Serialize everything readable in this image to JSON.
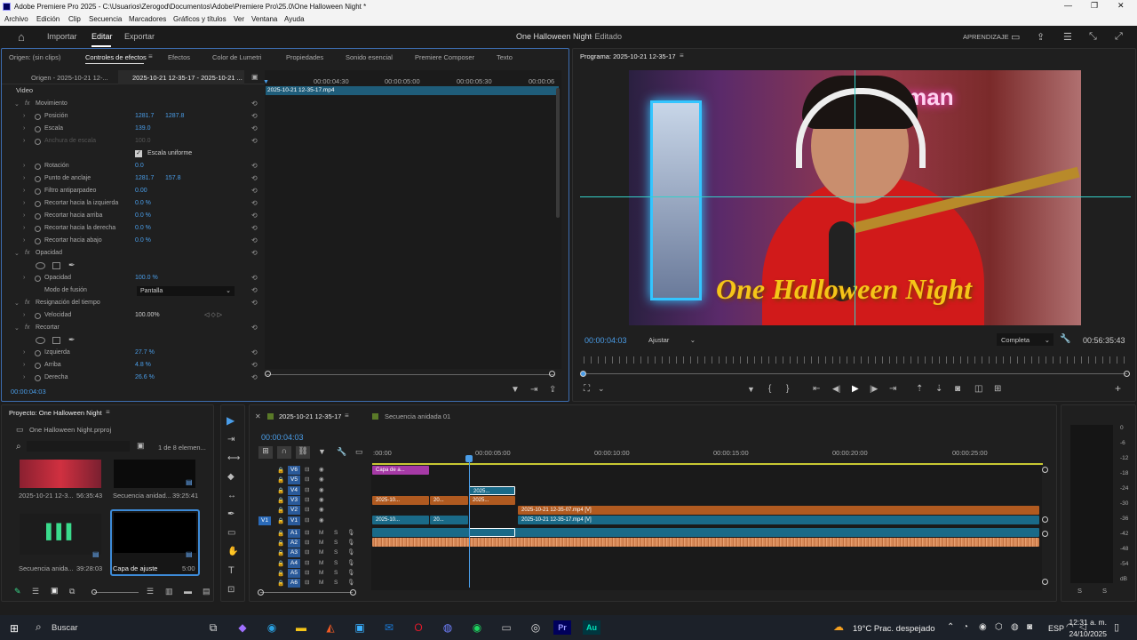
{
  "titlebar": {
    "title": "Adobe Premiere Pro 2025 - C:\\Usuarios\\Zerogod\\Documentos\\Adobe\\Premiere Pro\\25.0\\One Halloween Night *"
  },
  "menu": [
    "Archivo",
    "Edición",
    "Clip",
    "Secuencia",
    "Marcadores",
    "Gráficos y títulos",
    "Ver",
    "Ventana",
    "Ayuda"
  ],
  "appbar": {
    "import": "Importar",
    "edit": "Editar",
    "export": "Exportar",
    "project_title": "One Halloween Night",
    "project_state": "- Editado",
    "learn": "APRENDIZAJE"
  },
  "effects_panel": {
    "tabs": [
      "Origen: (sin clips)",
      "Controles de efectos",
      "Efectos",
      "Color de Lumetri",
      "Propiedades",
      "Sonido esencial",
      "Premiere Composer",
      "Texto"
    ],
    "subtabs": [
      "Origen - 2025-10-21 12-...",
      "2025-10-21 12-35-17 - 2025-10-21 ..."
    ],
    "ruler": [
      "00:00:04:30",
      "00:00:05:00",
      "00:00:05:30",
      "00:00:06"
    ],
    "clip_name": "2025-10-21 12-35-17.mp4",
    "section": "Video",
    "rows": [
      {
        "label": "Movimiento",
        "fx": true,
        "open": true
      },
      {
        "label": "Posición",
        "v1": "1281.7",
        "v2": "1287.8"
      },
      {
        "label": "Escala",
        "v1": "139.0"
      },
      {
        "label": "Anchura de escala",
        "v1": "100.0",
        "dim": true
      },
      {
        "label": "Escala uniforme",
        "check": true
      },
      {
        "label": "Rotación",
        "v1": "0.0"
      },
      {
        "label": "Punto de anclaje",
        "v1": "1281.7",
        "v2": "157.8"
      },
      {
        "label": "Filtro antiparpadeo",
        "v1": "0.00"
      },
      {
        "label": "Recortar hacia la izquierda",
        "v1": "0.0 %"
      },
      {
        "label": "Recortar hacia arriba",
        "v1": "0.0 %"
      },
      {
        "label": "Recortar hacia la derecha",
        "v1": "0.0 %"
      },
      {
        "label": "Recortar hacia abajo",
        "v1": "0.0 %"
      },
      {
        "label": "Opacidad",
        "fx": true,
        "open": true
      },
      {
        "label": "",
        "shapes": true
      },
      {
        "label": "Opacidad",
        "v1": "100.0 %"
      },
      {
        "label": "Modo de fusión",
        "select": "Pantalla"
      },
      {
        "label": "Resignación del tiempo",
        "fx": true,
        "open": true
      },
      {
        "label": "Velocidad",
        "v1": "100.00%",
        "white": true
      },
      {
        "label": "Recortar",
        "fx": true,
        "open": true
      },
      {
        "label": "",
        "shapes": true
      },
      {
        "label": "Izquierda",
        "v1": "27.7 %"
      },
      {
        "label": "Arriba",
        "v1": "4.8 %"
      },
      {
        "label": "Derecha",
        "v1": "26.6 %"
      }
    ],
    "timecode": "00:00:04:03"
  },
  "program": {
    "title": "Programa: 2025-10-21 12-35-17",
    "overlay_text": "One Halloween Night",
    "sign_text": "naGerman",
    "timecode": "00:00:04:03",
    "fit": "Ajustar",
    "quality": "Completa",
    "duration": "00:56:35:43"
  },
  "project": {
    "title": "Proyecto: One Halloween Night",
    "file": "One Halloween Night.prproj",
    "count": "1 de 8 elemen...",
    "items": [
      {
        "name": "2025-10-21 12-3...",
        "dur": "56:35:43"
      },
      {
        "name": "Secuencia anidad...",
        "dur": "39:25:41"
      },
      {
        "name": "Secuencia anida...",
        "dur": "39:28:03"
      },
      {
        "name": "Capa de ajuste",
        "dur": "5:00"
      }
    ]
  },
  "timeline": {
    "tab1": "2025-10-21 12-35-17",
    "tab2": "Secuencia anidada 01",
    "timecode": "00:00:04:03",
    "ruler": [
      ":00:00",
      "00:00:05:00",
      "00:00:10:00",
      "00:00:15:00",
      "00:00:20:00",
      "00:00:25:00"
    ],
    "video_tracks": [
      "V6",
      "V5",
      "V4",
      "V3",
      "V2",
      "V1"
    ],
    "audio_tracks": [
      "A1",
      "A2",
      "A3",
      "A4",
      "A5",
      "A6"
    ],
    "clips": {
      "adj": "Capa de a...",
      "v4": "2025...",
      "v3a": "2025-10...",
      "v3b": "20...",
      "v3c": "2025...",
      "v2": "2025-10-21 12-35-07.mp4 [V]",
      "v1a": "2025-10...",
      "v1b": "20...",
      "v1c": "2025-10-21 12-35-17.mp4 [V]"
    }
  },
  "meter": {
    "scale": [
      "0",
      "-6",
      "-12",
      "-18",
      "-24",
      "-30",
      "-36",
      "-42",
      "-48",
      "-54",
      "dB"
    ],
    "s": "S"
  },
  "taskbar": {
    "search": "Buscar",
    "weather": "19°C  Prac. despejado",
    "lang": "ESP",
    "time": "12:31 a. m.",
    "date": "24/10/2025"
  }
}
